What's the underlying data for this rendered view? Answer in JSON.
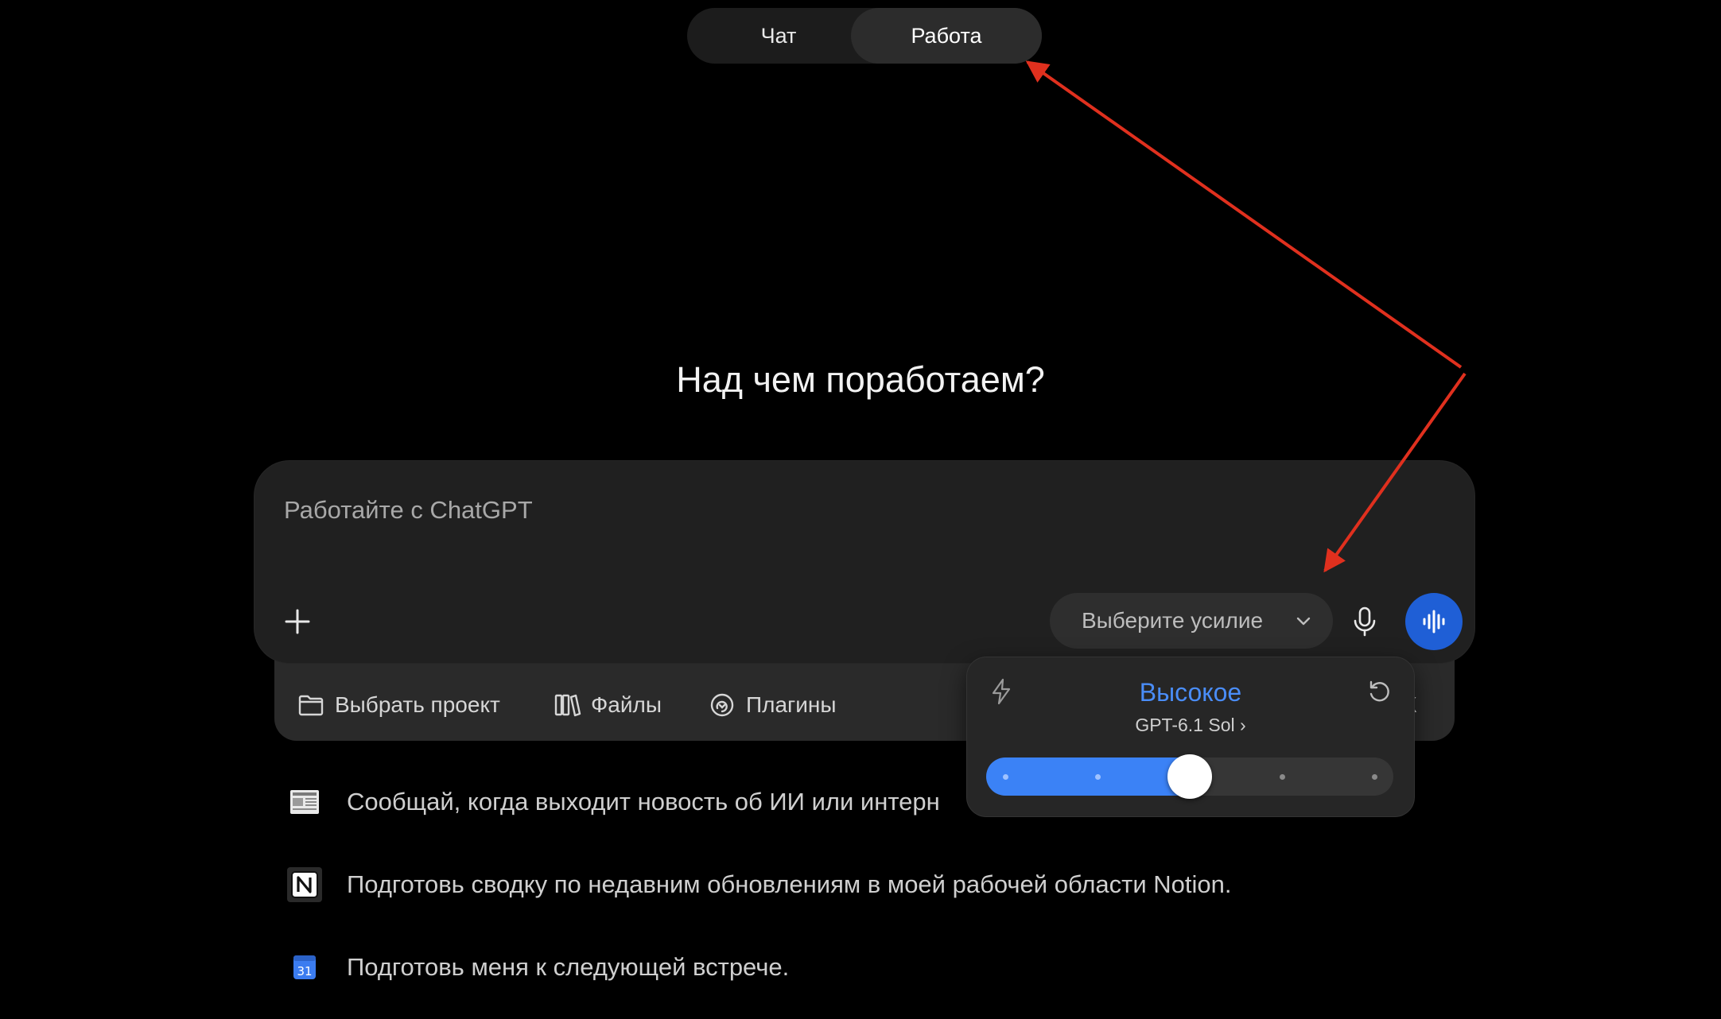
{
  "mode_switch": {
    "tabs": [
      {
        "label": "Чат",
        "active": false
      },
      {
        "label": "Работа",
        "active": true
      }
    ]
  },
  "heading": "Над чем поработаем?",
  "composer": {
    "placeholder": "Работайте с ChatGPT",
    "value": "",
    "effort_select_label": "Выберите усилие",
    "icons": {
      "add": "plus-icon",
      "mic": "microphone-icon",
      "voice": "voice-wave-icon",
      "chevron": "chevron-down-icon"
    }
  },
  "tools": {
    "project_label": "Выбрать проект",
    "files_label": "Файлы",
    "plugins_label": "Плагины",
    "truncated_label": "К"
  },
  "effort_popup": {
    "level": "Высокое",
    "model": "GPT-6.1 Sol",
    "level_index": 2,
    "level_count": 5,
    "icons": {
      "left": "bolt-icon",
      "right": "reset-icon"
    }
  },
  "suggestions": [
    {
      "text": "Сообщай, когда выходит новость об ИИ или интерн",
      "icon": "news-icon"
    },
    {
      "text": "Подготовь сводку по недавним обновлениям в моей рабочей области Notion.",
      "icon": "notion-icon"
    },
    {
      "text": "Подготовь меня к следующей встрече.",
      "icon": "calendar-icon",
      "icon_text": "31"
    }
  ],
  "colors": {
    "background": "#000000",
    "accent": "#3b82f6",
    "voice_button": "#1f5fd6",
    "annotation_arrow": "#e0301e"
  }
}
